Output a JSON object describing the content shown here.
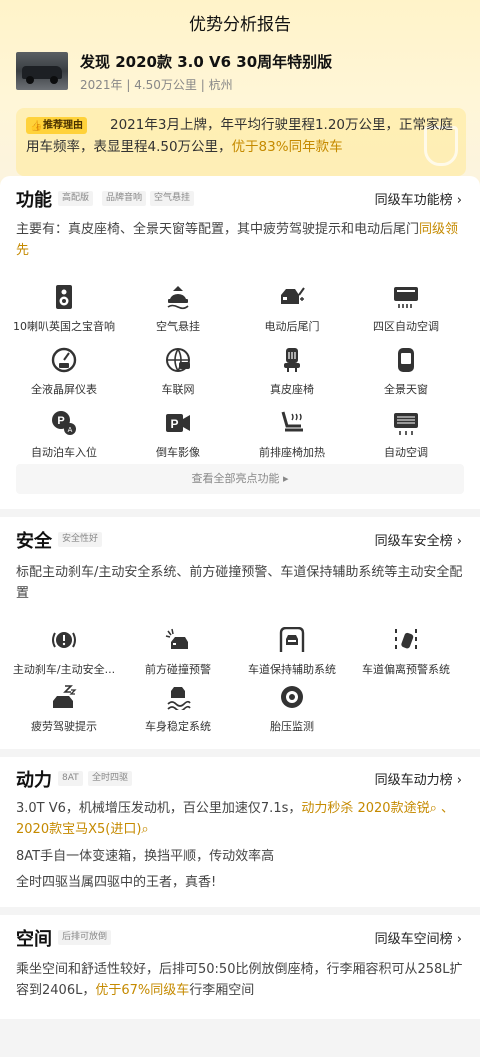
{
  "page": {
    "title": "优势分析报告"
  },
  "car": {
    "name": "发现 2020款 3.0 V6 30周年特别版",
    "meta": "2021年 | 4.50万公里 | 杭州"
  },
  "reason": {
    "badge": "推荐理由",
    "text": "2021年3月上牌，年平均行驶里程1.20万公里，正常家庭用车频率，表显里程4.50万公里，",
    "highlight": "优于83%同年款车"
  },
  "function": {
    "title": "功能",
    "tags": [
      "高配版",
      "品牌音响",
      "空气悬挂"
    ],
    "rank": "同级车功能榜 ›",
    "desc": "主要有：真皮座椅、全景天窗等配置，其中疲劳驾驶提示和电动后尾门",
    "desc_hl": "同级领先",
    "items": [
      {
        "label": "10喇叭英国之宝音响",
        "icon": "speaker-icon"
      },
      {
        "label": "空气悬挂",
        "icon": "air-suspension-icon"
      },
      {
        "label": "电动后尾门",
        "icon": "power-tailgate-icon"
      },
      {
        "label": "四区自动空调",
        "icon": "climate-control-icon"
      },
      {
        "label": "全液晶屏仪表",
        "icon": "lcd-dashboard-icon"
      },
      {
        "label": "车联网",
        "icon": "connected-car-icon"
      },
      {
        "label": "真皮座椅",
        "icon": "leather-seat-icon"
      },
      {
        "label": "全景天窗",
        "icon": "sunroof-icon"
      },
      {
        "label": "自动泊车入位",
        "icon": "auto-parking-icon"
      },
      {
        "label": "倒车影像",
        "icon": "reverse-camera-icon"
      },
      {
        "label": "前排座椅加热",
        "icon": "seat-heating-icon"
      },
      {
        "label": "自动空调",
        "icon": "auto-ac-icon"
      }
    ],
    "more": "查看全部亮点功能 ▸"
  },
  "safety": {
    "title": "安全",
    "tags": [
      "安全性好"
    ],
    "rank": "同级车安全榜 ›",
    "desc": "标配主动刹车/主动安全系统、前方碰撞预警、车道保持辅助系统等主动安全配置",
    "items": [
      {
        "label": "主动刹车/主动安全...",
        "icon": "brake-warning-icon"
      },
      {
        "label": "前方碰撞预警",
        "icon": "collision-warning-icon"
      },
      {
        "label": "车道保持辅助系统",
        "icon": "lane-keep-icon"
      },
      {
        "label": "车道偏离预警系统",
        "icon": "lane-departure-icon"
      },
      {
        "label": "疲劳驾驶提示",
        "icon": "fatigue-icon"
      },
      {
        "label": "车身稳定系统",
        "icon": "stability-icon"
      },
      {
        "label": "胎压监测",
        "icon": "tire-pressure-icon"
      }
    ]
  },
  "power": {
    "title": "动力",
    "tags": [
      "8AT",
      "全时四驱"
    ],
    "rank": "同级车动力榜 ›",
    "line1": "3.0T V6，机械增压发动机，百公里加速仅7.1s，",
    "line1_hl": "动力秒杀 2020款途锐",
    "line1_hl2": "2020款宝马X5(进口)",
    "line2": "8AT手自一体变速箱，换挡平顺，传动效率高",
    "line3": "全时四驱当属四驱中的王者，真香!"
  },
  "space": {
    "title": "空间",
    "tags": [
      "后排可放倒"
    ],
    "rank": "同级车空间榜 ›",
    "desc": "乘坐空间和舒适性较好，后排可50:50比例放倒座椅，行李厢容积可从258L扩容到2406L，",
    "desc_hl": "优于67%同级车",
    "desc_tail": "行李厢空间"
  },
  "colors": {
    "accent": "#c58a00",
    "badge": "#ffd23a",
    "hero": "#fff3c9"
  }
}
